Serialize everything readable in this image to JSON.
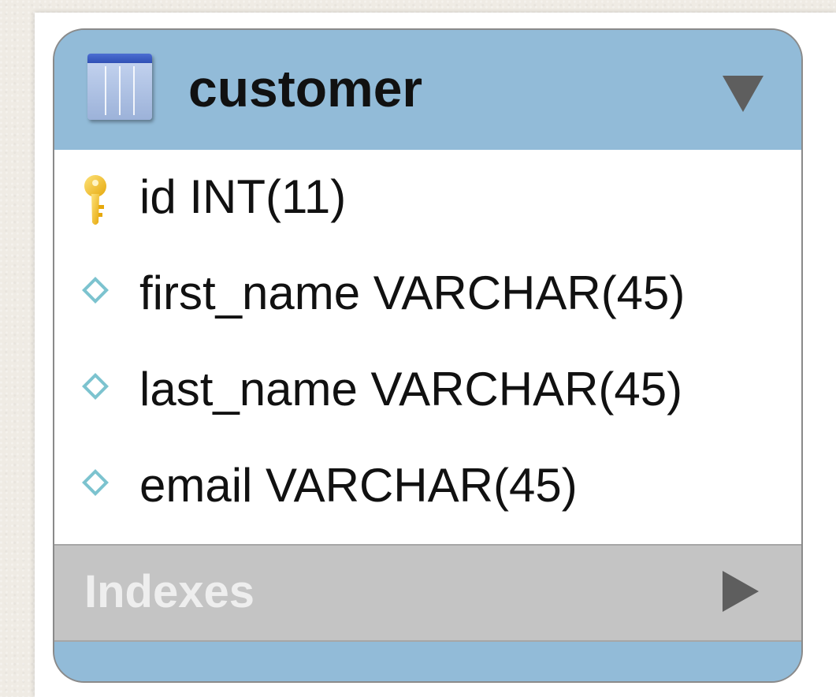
{
  "table": {
    "name": "customer",
    "icon": "table-icon",
    "collapse_icon": "triangle-down-icon",
    "columns": [
      {
        "label": "id INT(11)",
        "icon": "primary-key-icon"
      },
      {
        "label": "first_name VARCHAR(45)",
        "icon": "column-diamond-icon"
      },
      {
        "label": "last_name VARCHAR(45)",
        "icon": "column-diamond-icon"
      },
      {
        "label": "email VARCHAR(45)",
        "icon": "column-diamond-icon"
      }
    ],
    "indexes": {
      "label": "Indexes",
      "expand_icon": "triangle-right-icon"
    }
  },
  "colors": {
    "header": "#92bbd8",
    "indexes_bar": "#c4c4c4",
    "key": "#f2c21b",
    "diamond": "#7cc3cf"
  }
}
